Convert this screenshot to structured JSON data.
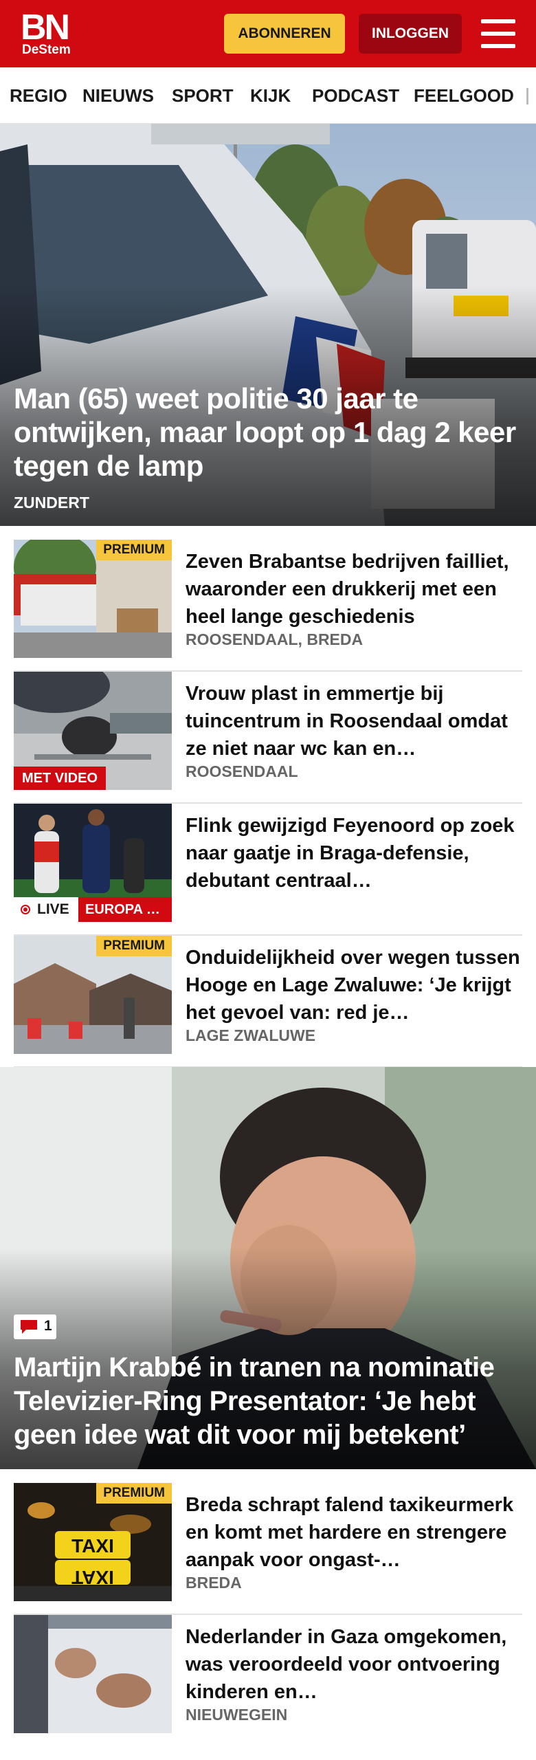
{
  "header": {
    "logo_main": "BN",
    "logo_sub": "DeStem",
    "subscribe_label": "ABONNEREN",
    "login_label": "INLOGGEN",
    "menu_icon": "hamburger-menu-icon"
  },
  "nav": {
    "items": [
      "REGIO",
      "NIEUWS",
      "SPORT",
      "KIJK",
      "PODCAST",
      "FEELGOOD"
    ]
  },
  "hero": {
    "title": "Man (65) weet politie 30 jaar te ontwijken, maar loopt op 1 dag 2 keer tegen de lamp",
    "location": "ZUNDERT"
  },
  "articles": [
    {
      "title": "Zeven Brabantse bedrijven failliet, waaronder een drukkerij met een heel lange geschiedenis",
      "location": "ROOSENDAAL, BREDA",
      "badge": "PREMIUM"
    },
    {
      "title": "Vrouw plast in emmertje bij tuincentrum in Roosendaal omdat ze niet naar wc kan en…",
      "location": "ROOSENDAAL",
      "badge": "MET VIDEO"
    },
    {
      "title": "Flink gewijzigd Feyenoord op zoek naar gaatje in Braga-defensie, debutant centraal…",
      "location": "",
      "live_label": "LIVE",
      "category": "EUROPA …"
    },
    {
      "title": "Onduidelijkheid over wegen tussen Hooge en Lage Zwaluwe: ‘Je krijgt het gevoel van: red je…",
      "location": "LAGE ZWALUWE",
      "badge": "PREMIUM"
    }
  ],
  "feature": {
    "comment_count": "1",
    "title": "Martijn Krabbé in tranen na nominatie Televizier-Ring Presentator: ‘Je hebt geen idee wat dit voor mij betekent’"
  },
  "articles_bottom": [
    {
      "title": "Breda schrapt falend taxikeur­merk en komt met hardere en strengere aanpak voor ongast-…",
      "location": "BREDA",
      "badge": "PREMIUM",
      "thumb_text": "TAXI"
    },
    {
      "title": "Nederlander in Gaza omgekomen, was veroordeeld voor ontvoering kinderen en…",
      "location": "NIEUWEGEIN"
    }
  ],
  "colors": {
    "brand_red": "#d10a11",
    "premium_yellow": "#f7c53b",
    "login_dark_red": "#9b0610"
  }
}
